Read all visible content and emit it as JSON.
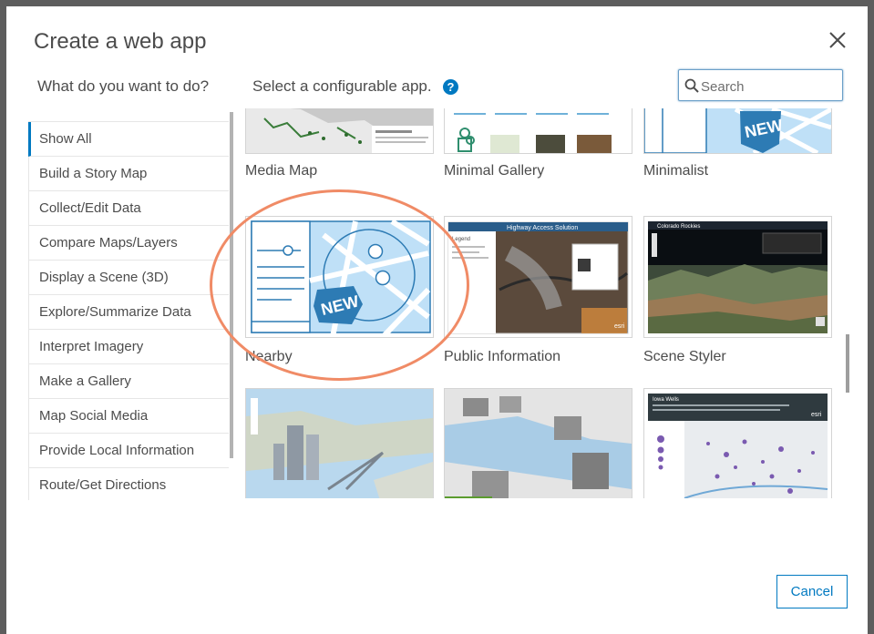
{
  "dialog": {
    "title": "Create a web app",
    "question_left": "What do you want to do?",
    "question_right": "Select a configurable app.",
    "help_icon": "?",
    "search_placeholder": "Search",
    "cancel_label": "Cancel"
  },
  "sidebar": {
    "items": [
      {
        "label": "Show All",
        "active": true
      },
      {
        "label": "Build a Story Map"
      },
      {
        "label": "Collect/Edit Data"
      },
      {
        "label": "Compare Maps/Layers"
      },
      {
        "label": "Display a Scene (3D)"
      },
      {
        "label": "Explore/Summarize Data"
      },
      {
        "label": "Interpret Imagery"
      },
      {
        "label": "Make a Gallery"
      },
      {
        "label": "Map Social Media"
      },
      {
        "label": "Provide Local Information"
      },
      {
        "label": "Route/Get Directions"
      }
    ]
  },
  "apps": [
    {
      "label": "Media Map"
    },
    {
      "label": "Minimal Gallery"
    },
    {
      "label": "Minimalist",
      "badge": "NEW"
    },
    {
      "label": "Nearby",
      "badge": "NEW"
    },
    {
      "label": "Public Information",
      "thumb_title": "Highway Access Solution",
      "thumb_sidebar": "Legend",
      "thumb_brand": "esri"
    },
    {
      "label": "Scene Styler",
      "thumb_title": "Colorado Rockies"
    },
    {
      "label": ""
    },
    {
      "label": ""
    },
    {
      "label": "",
      "thumb_title": "Iowa Wells",
      "thumb_brand": "esri"
    }
  ],
  "colors": {
    "accent": "#0079c1",
    "highlight": "#f08b66",
    "badge_blue": "#2d7bb4",
    "map_light": "#bfe0f7"
  },
  "icons": {
    "close": "close-icon",
    "search": "search-icon",
    "help": "help-icon",
    "badge": "new-badge-icon"
  }
}
